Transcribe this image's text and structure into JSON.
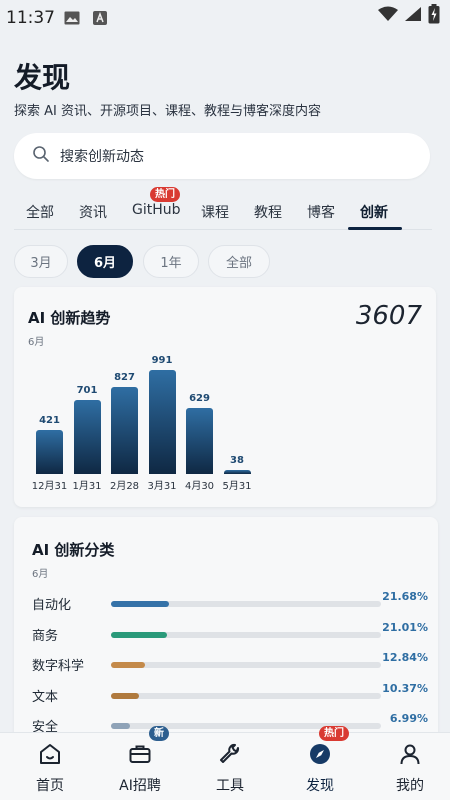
{
  "status_bar": {
    "time": "11:37"
  },
  "header": {
    "title": "发现",
    "subtitle": "探索 AI 资讯、开源项目、课程、教程与博客深度内容"
  },
  "search": {
    "placeholder": "搜索创新动态"
  },
  "tabs": [
    {
      "label": "全部"
    },
    {
      "label": "资讯"
    },
    {
      "label": "GitHub",
      "badge": "热门"
    },
    {
      "label": "课程"
    },
    {
      "label": "教程"
    },
    {
      "label": "博客"
    },
    {
      "label": "创新",
      "active": true
    }
  ],
  "ranges": [
    {
      "label": "3月"
    },
    {
      "label": "6月",
      "active": true
    },
    {
      "label": "1年"
    },
    {
      "label": "全部"
    }
  ],
  "trend_card": {
    "title": "AI 创新趋势",
    "period": "6月",
    "total": "3607"
  },
  "chart_data": {
    "type": "bar",
    "title": "AI 创新趋势",
    "categories": [
      "12月31",
      "1月31",
      "2月28",
      "3月31",
      "4月30",
      "5月31"
    ],
    "values": [
      421,
      701,
      827,
      991,
      629,
      38
    ],
    "value_labels": [
      "421",
      "701",
      "827",
      "991",
      "629",
      "38"
    ],
    "ylim": [
      0,
      1000
    ],
    "grid": false,
    "colors": {
      "bar_top": "#2f6ea3",
      "bar_bottom": "#0f2843"
    }
  },
  "category_card": {
    "title": "AI 创新分类",
    "period": "6月",
    "items": [
      {
        "name": "自动化",
        "percent": "21.68%",
        "value": 21.68,
        "color": "#3572a8"
      },
      {
        "name": "商务",
        "percent": "21.01%",
        "value": 21.01,
        "color": "#2a9a7a"
      },
      {
        "name": "数字科学",
        "percent": "12.84%",
        "value": 12.84,
        "color": "#c48a4a"
      },
      {
        "name": "文本",
        "percent": "10.37%",
        "value": 10.37,
        "color": "#b07a3e"
      },
      {
        "name": "安全",
        "percent": "6.99%",
        "value": 6.99,
        "color": "#8fa3b8"
      }
    ]
  },
  "bottom_nav": [
    {
      "label": "首页",
      "icon": "home-icon"
    },
    {
      "label": "AI招聘",
      "icon": "briefcase-icon",
      "badge": "新"
    },
    {
      "label": "工具",
      "icon": "wrench-icon"
    },
    {
      "label": "发现",
      "icon": "compass-icon",
      "badge": "热门",
      "active": true
    },
    {
      "label": "我的",
      "icon": "person-icon"
    }
  ],
  "colors": {
    "primary": "#0d2340",
    "hot": "#d93a32",
    "new_badge": "#2e5f8f"
  }
}
